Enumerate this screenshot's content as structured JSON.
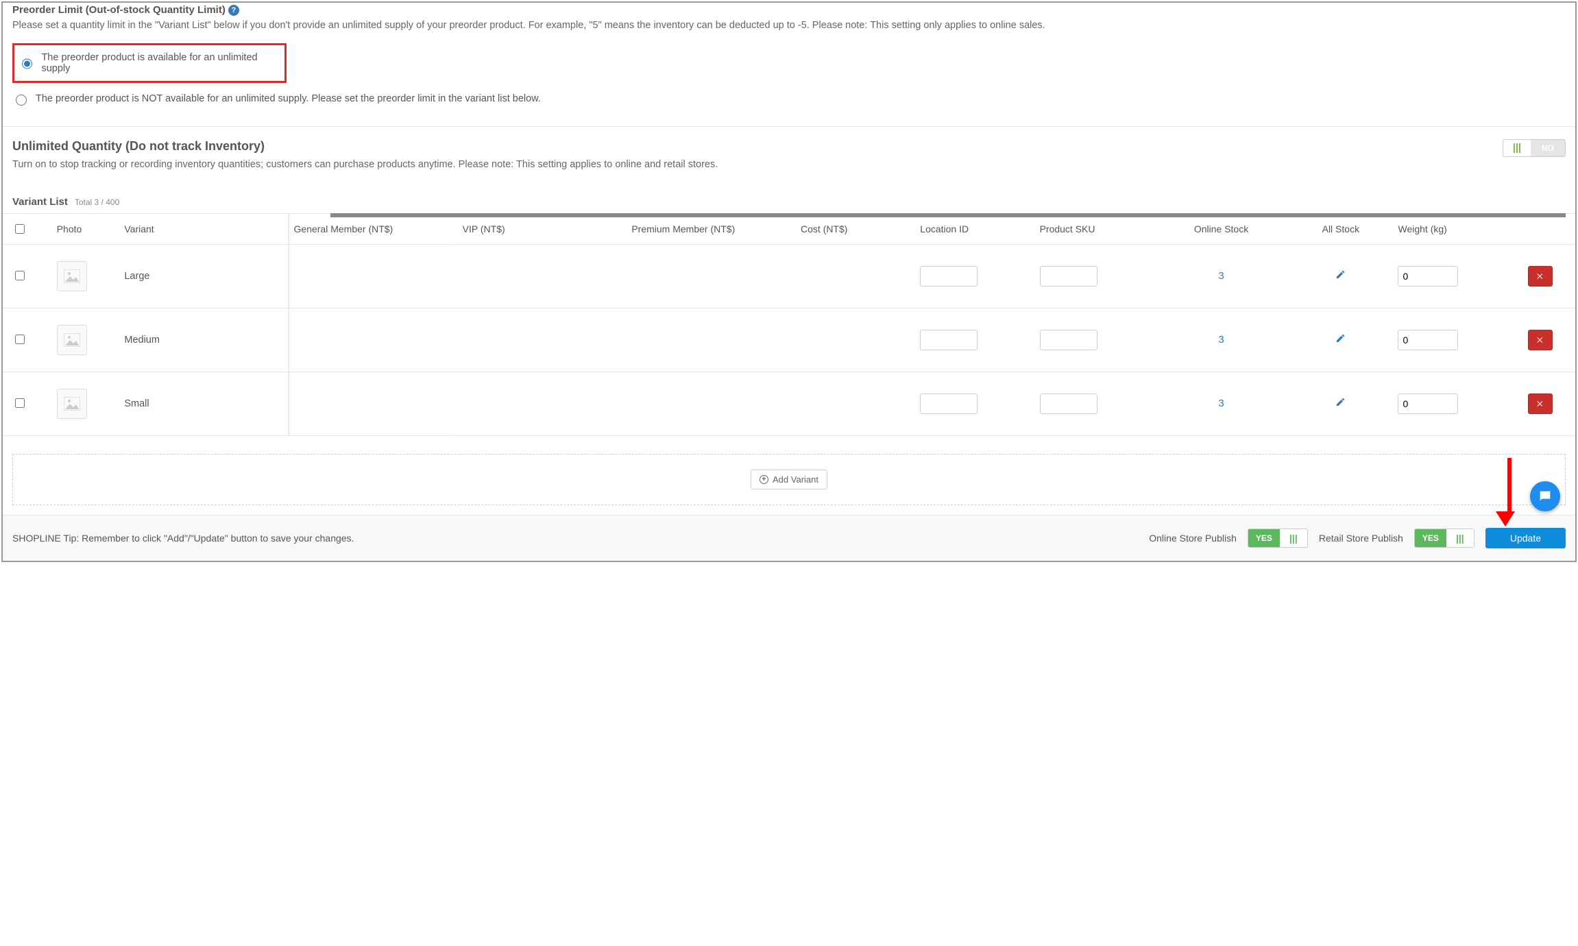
{
  "preorder": {
    "title": "Preorder Limit (Out-of-stock Quantity Limit)",
    "desc": "Please set a quantity limit in the \"Variant List\" below if you don't provide an unlimited supply of your preorder product. For example, \"5\" means the inventory can be deducted up to -5. Please note: This setting only applies to online sales.",
    "opt_unlimited": "The preorder product is available for an unlimited supply",
    "opt_limited": "The preorder product is NOT available for an unlimited supply. Please set the preorder limit in the variant list below."
  },
  "unlimited": {
    "title": "Unlimited Quantity (Do not track Inventory)",
    "desc": "Turn on to stop tracking or recording inventory quantities; customers can purchase products anytime. Please note: This setting applies to online and retail stores.",
    "toggle_no": "NO"
  },
  "variant_list": {
    "title": "Variant List",
    "count": "Total 3 / 400",
    "add_label": "Add Variant",
    "headers": {
      "photo": "Photo",
      "variant": "Variant",
      "general_member": "General Member (NT$)",
      "vip": "VIP (NT$)",
      "premium_member": "Premium Member (NT$)",
      "cost": "Cost (NT$)",
      "location_id": "Location ID",
      "product_sku": "Product SKU",
      "online_stock": "Online Stock",
      "all_stock": "All Stock",
      "weight": "Weight (kg)"
    },
    "rows": [
      {
        "variant": "Large",
        "location_id": "",
        "product_sku": "",
        "online_stock": "3",
        "weight": "0"
      },
      {
        "variant": "Medium",
        "location_id": "",
        "product_sku": "",
        "online_stock": "3",
        "weight": "0"
      },
      {
        "variant": "Small",
        "location_id": "",
        "product_sku": "",
        "online_stock": "3",
        "weight": "0"
      }
    ]
  },
  "footer": {
    "tip": "SHOPLINE Tip: Remember to click \"Add\"/\"Update\" button to save your changes.",
    "online_store_publish": "Online Store Publish",
    "retail_store_publish": "Retail Store Publish",
    "yes": "YES",
    "update": "Update"
  }
}
